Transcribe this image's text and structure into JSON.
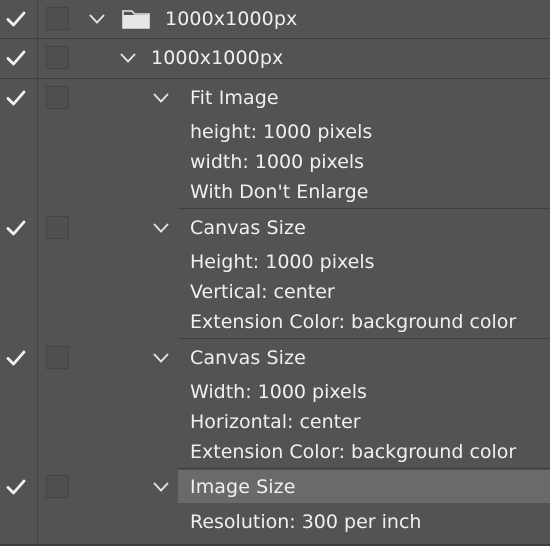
{
  "actions_panel": {
    "set": {
      "name": "1000x1000px"
    },
    "action": {
      "name": "1000x1000px"
    },
    "steps": [
      {
        "name": "Fit Image",
        "details": [
          "height: 1000 pixels",
          "width: 1000 pixels",
          "With Don't Enlarge"
        ]
      },
      {
        "name": "Canvas Size",
        "details": [
          "Height: 1000 pixels",
          "Vertical: center",
          "Extension Color: background color"
        ]
      },
      {
        "name": "Canvas Size",
        "details": [
          "Width: 1000 pixels",
          "Horizontal: center",
          "Extension Color: background color"
        ]
      },
      {
        "name": "Image Size",
        "details": [
          "Resolution: 300 per inch"
        ],
        "selected": true
      }
    ]
  },
  "colors": {
    "panel_bg": "#535353",
    "text": "#f0f0f0",
    "selected_row": "#6a6a6a"
  }
}
